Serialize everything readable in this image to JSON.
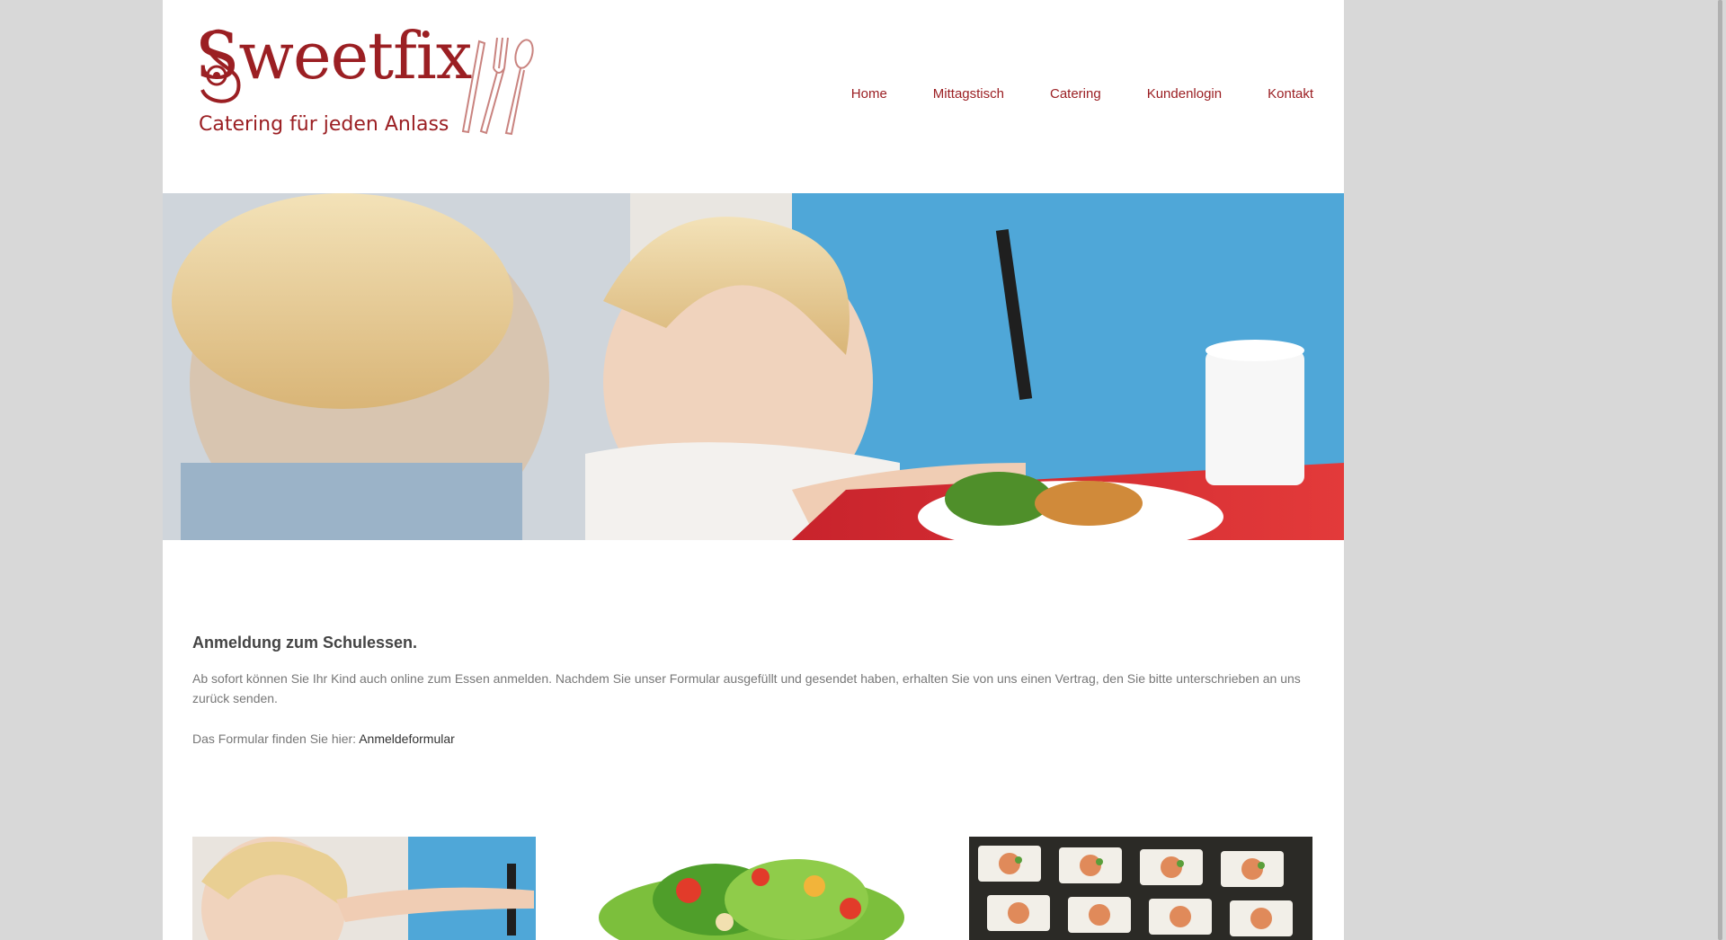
{
  "brand": {
    "name": "Sweetfix",
    "tagline": "Catering für jeden Anlass",
    "color": "#9b1f23"
  },
  "nav": {
    "items": [
      {
        "label": "Home"
      },
      {
        "label": "Mittagstisch"
      },
      {
        "label": "Catering"
      },
      {
        "label": "Kundenlogin"
      },
      {
        "label": "Kontakt"
      }
    ]
  },
  "main": {
    "heading": "Anmeldung zum Schulessen.",
    "paragraph1": "Ab sofort können Sie Ihr Kind auch online zum Essen anmelden. Nachdem Sie unser Formular ausgefüllt und gesendet haben, erhalten Sie von uns einen Vertrag, den Sie bitte unterschrieben an uns zurück senden.",
    "form_prefix": "Das Formular finden Sie hier: ",
    "form_link": "Anmeldeformular"
  },
  "icons": {
    "logo": "sweetfix-logo",
    "cutlery": "cutlery-icon",
    "hero": "children-eating-photo",
    "thumb1": "children-eating-photo",
    "thumb2": "salad-photo",
    "thumb3": "finger-food-photo"
  }
}
